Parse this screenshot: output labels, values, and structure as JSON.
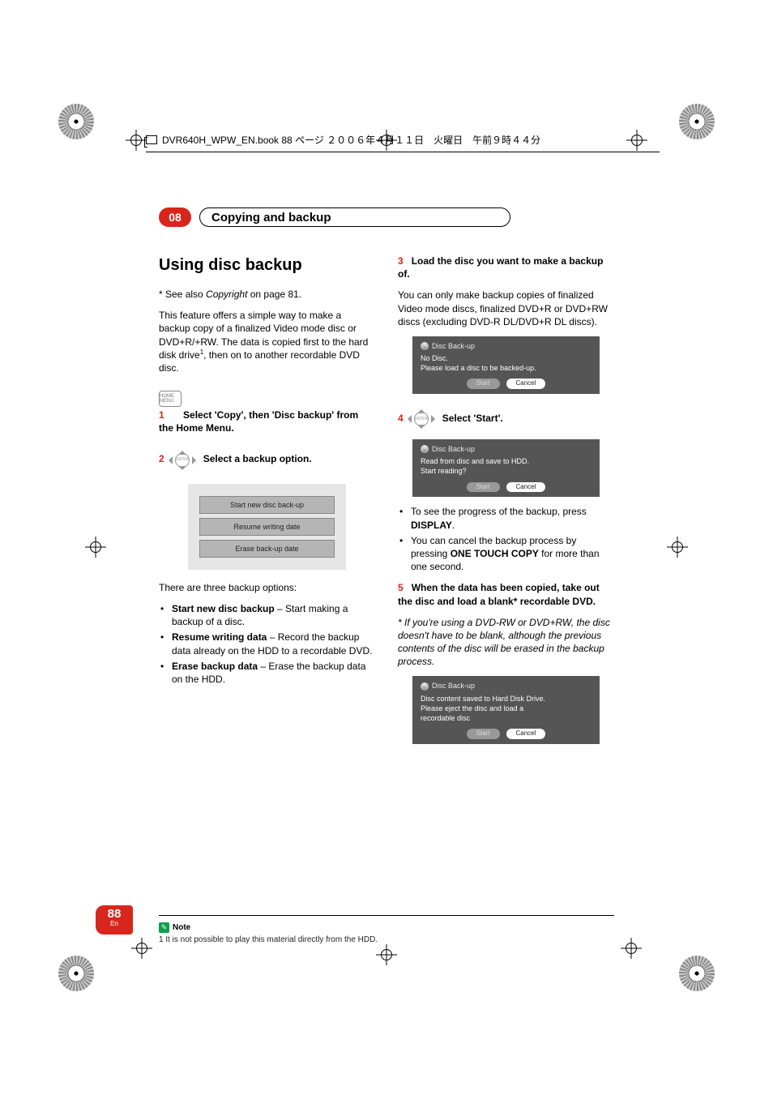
{
  "meta": {
    "header": "DVR640H_WPW_EN.book  88 ページ  ２００６年４月１１日　火曜日　午前９時４４分"
  },
  "chapter": {
    "number": "08",
    "title": "Copying and backup"
  },
  "left": {
    "heading": "Using disc backup",
    "seeAlsoPrefix": "* See also ",
    "seeAlsoItalic": "Copyright",
    "seeAlsoSuffix": " on page 81.",
    "intro1": "This feature offers a simple way to make a backup copy of a finalized Video mode disc or DVD+R/+RW. The data is copied first to the hard disk drive",
    "intro1sup": "1",
    "intro1b": ", then on to another recordable DVD disc.",
    "homeIcon": "HOME MENU",
    "step1num": "1",
    "step1text": "Select 'Copy', then 'Disc backup' from the Home Menu.",
    "enterLabel": "ENTER",
    "step2num": "2",
    "step2text": "Select a backup option.",
    "panelOptions": {
      "a": "Start new disc back-up",
      "b": "Resume writing date",
      "c": "Erase back-up date"
    },
    "threeOptions": "There are three backup options:",
    "bullets": {
      "a_bold": "Start new disc backup",
      "a_rest": " – Start making a backup of a disc.",
      "b_bold": "Resume writing data",
      "b_rest": " – Record the backup data already on the HDD to a recordable DVD.",
      "c_bold": "Erase backup data",
      "c_rest": " – Erase the backup data on the HDD."
    }
  },
  "right": {
    "step3num": "3",
    "step3text": "Load the disc you want to make a backup of.",
    "step3para": "You can only make backup copies of finalized Video mode discs, finalized DVD+R or  DVD+RW discs (excluding DVD-R DL/DVD+R DL discs).",
    "panel1": {
      "title": "Disc Back-up",
      "line1": "No Disc.",
      "line2": "Please load a disc to be backed-up.",
      "start": "Start",
      "cancel": "Cancel"
    },
    "enterLabel": "ENTER",
    "step4num": "4",
    "step4text": "Select 'Start'.",
    "panel2": {
      "title": "Disc Back-up",
      "line1": "Read from disc and save to HDD.",
      "line2": "Start reading?",
      "start": "Start",
      "cancel": "Cancel"
    },
    "bullets": {
      "a_pre": "To see the progress of the backup, press ",
      "a_bold": "DISPLAY",
      "a_post": ".",
      "b_pre": "You can cancel the backup process by pressing ",
      "b_bold": "ONE TOUCH COPY",
      "b_post": " for more than one second."
    },
    "step5num": "5",
    "step5text": "When the data has been copied, take out the disc and load a blank* recordable DVD.",
    "step5italic": "* If you're using a DVD-RW or DVD+RW, the disc doesn't have to be blank, although the previous contents of the disc will be erased in the backup process.",
    "panel3": {
      "title": "Disc Back-up",
      "line1": "Disc content saved to Hard Disk Drive.",
      "line2": "Please eject the disc and load a",
      "line3": "recordable disc",
      "start": "Start",
      "cancel": "Cancel"
    }
  },
  "note": {
    "label": "Note",
    "text": "1 It is not possible to play this material directly from the HDD."
  },
  "page": {
    "num": "88",
    "lang": "En"
  }
}
